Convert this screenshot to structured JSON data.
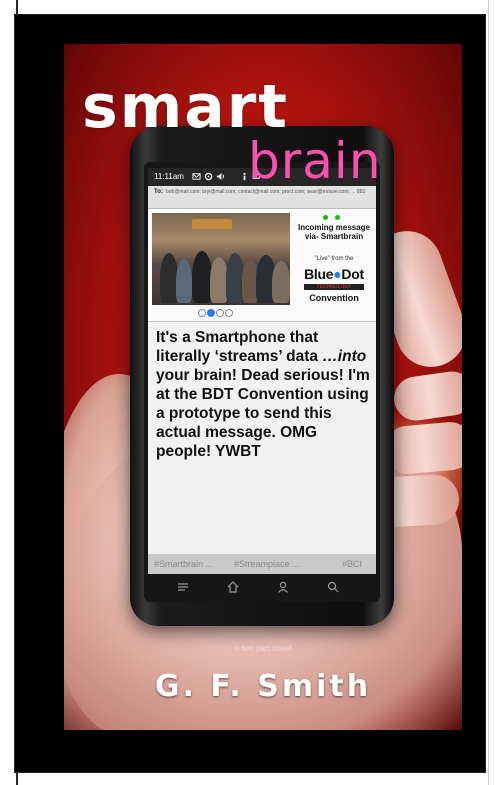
{
  "cover": {
    "title_word1": "smart",
    "title_word2": "brain",
    "subtitle": "a two part novel",
    "author": "G. F. Smith",
    "colors": {
      "background_red": "#c11812",
      "title_white": "#ffffff",
      "title_pink": "#ff4fb0",
      "frame_black": "#000000"
    }
  },
  "phone": {
    "status_time": "11:11am",
    "status_icons": [
      "email-icon",
      "settings-icon",
      "volume-icon",
      "info-icon",
      "battery-icon"
    ],
    "to_label": "To:",
    "to_value": "bob@mail.com; bryl@mail.com; contact@mail.com; proct.com; sean@mouse.com; ... 8817 ..."
  },
  "hero": {
    "incoming": "Incoming message via- Smartbrain",
    "live": "\"Live\" from the",
    "bluedot_part1": "Blue",
    "bluedot_part2": "Dot",
    "tech_bar": "TECHNOLOGY",
    "convention": "Convention",
    "carousel_dots": 4,
    "carousel_active": 1
  },
  "message": {
    "part1": "It's a Smartphone that literally ‘streams’ data ",
    "emph": "…into",
    "part2": " your brain! Dead serious! I'm at the BDT Convention using a prototype to send this actual message. OMG people! YWBT"
  },
  "tags": [
    "#Smartbrain ...",
    "#Streamplace ...",
    "#BCI"
  ],
  "navbar": [
    "menu-icon",
    "home-icon",
    "profile-icon",
    "search-icon"
  ]
}
